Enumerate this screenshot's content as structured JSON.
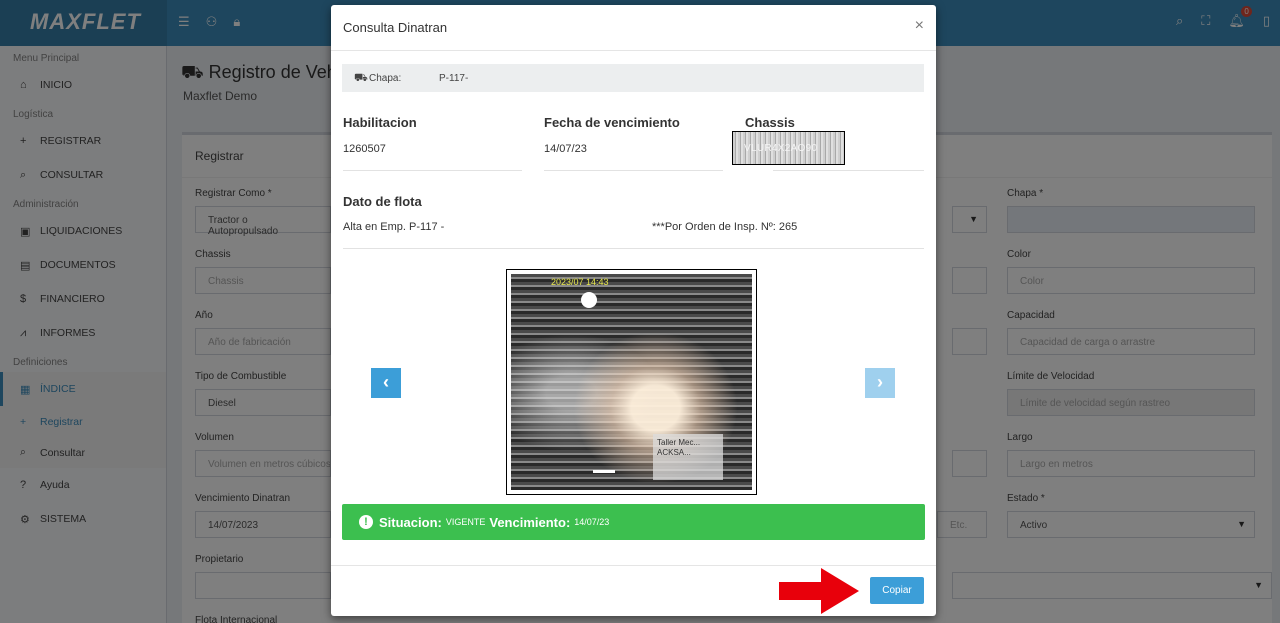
{
  "app": {
    "logo": "MAXFLET",
    "notif_count": "0"
  },
  "sidebar": {
    "sections": {
      "menu_principal": "Menu Principal",
      "logistica": "Logística",
      "administracion": "Administración",
      "definiciones": "Definiciones"
    },
    "items": {
      "inicio": "INICIO",
      "registrar": "REGISTRAR",
      "consultar": "CONSULTAR",
      "liquidaciones": "LIQUIDACIONES",
      "documentos": "DOCUMENTOS",
      "financiero": "FINANCIERO",
      "informes": "INFORMES",
      "indice": "ÍNDICE",
      "sub_registrar": "Registrar",
      "sub_consultar": "Consultar",
      "ayuda": "Ayuda",
      "sistema": "SISTEMA"
    }
  },
  "page": {
    "title": "Registro de Vehí",
    "subtitle": "Maxflet Demo",
    "box_title": "Registrar"
  },
  "form": {
    "registrar_como_label": "Registrar Como *",
    "registrar_como_value": "Tractor o Autopropulsado",
    "chassis_label": "Chassis",
    "chassis_placeholder": "Chassis",
    "anio_label": "Año",
    "anio_placeholder": "Año de fabricación",
    "combustible_label": "Tipo de Combustible",
    "combustible_value": "Diesel",
    "volumen_label": "Volumen",
    "volumen_placeholder": "Volumen en metros cúbicos",
    "venc_label": "Vencimiento Dinatran",
    "venc_value": "14/07/2023",
    "propietario_label": "Propietario",
    "flota_label": "Flota Internacional",
    "chapa_label": "Chapa *",
    "color_label": "Color",
    "color_placeholder": "Color",
    "capacidad_label": "Capacidad",
    "capacidad_placeholder": "Capacidad de carga o arrastre",
    "limite_label": "Límite de Velocidad",
    "limite_placeholder": "Límite de velocidad según rastreo",
    "largo_label": "Largo",
    "largo_placeholder": "Largo en metros",
    "estado_label": "Estado *",
    "estado_value": "Activo",
    "etc_text": "Etc."
  },
  "modal": {
    "title": "Consulta Dinatran",
    "close": "×",
    "chapa_label": "Chapa:",
    "chapa_value": "P-117-",
    "habilitacion_label": "Habilitacion",
    "habilitacion_value": "1260507",
    "fecha_label": "Fecha de vencimiento",
    "fecha_value": "14/07/23",
    "chassis_label": "Chassis",
    "chassis_value": "VLUR4X2AO90",
    "dato_flota_label": "Dato de flota",
    "alta_text": "Alta en Emp. P-117 -",
    "orden_text": "***Por Orden de Insp. Nº: 265",
    "photo_timestamp": "2023/07 14:43",
    "photo_sign": "Taller Mec... ACKSA...",
    "situacion_label": "Situacion:",
    "situacion_value": "VIGENTE",
    "vencimiento_label": "Vencimiento:",
    "vencimiento_value": "14/07/23",
    "copy_button": "Copiar"
  }
}
